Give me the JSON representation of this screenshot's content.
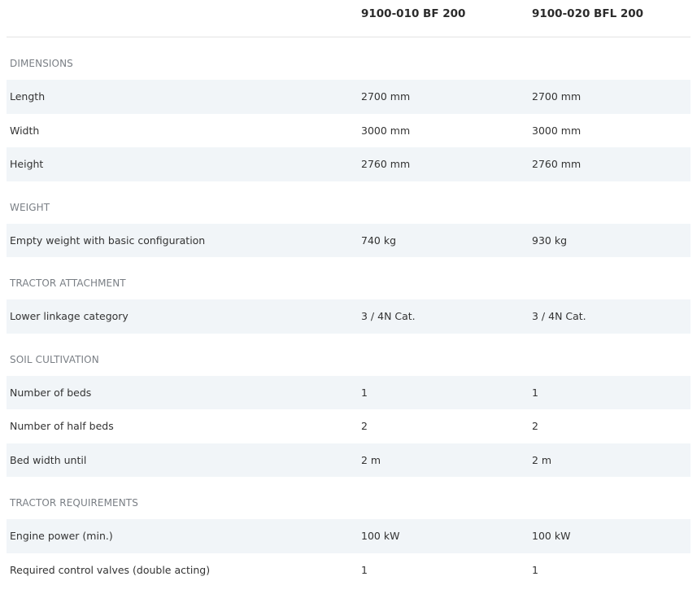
{
  "header": {
    "col1": "9100-010 BF 200",
    "col2": "9100-020 BFL 200"
  },
  "sections": [
    {
      "title": "DIMENSIONS",
      "rows": [
        {
          "label": "Length",
          "v1": "2700 mm",
          "v2": "2700 mm"
        },
        {
          "label": "Width",
          "v1": "3000 mm",
          "v2": "3000 mm"
        },
        {
          "label": "Height",
          "v1": "2760 mm",
          "v2": "2760 mm"
        }
      ]
    },
    {
      "title": "WEIGHT",
      "rows": [
        {
          "label": "Empty weight with basic configuration",
          "v1": "740 kg",
          "v2": "930 kg"
        }
      ]
    },
    {
      "title": "TRACTOR ATTACHMENT",
      "rows": [
        {
          "label": "Lower linkage category",
          "v1": "3 / 4N Cat.",
          "v2": "3 / 4N Cat."
        }
      ]
    },
    {
      "title": "SOIL CULTIVATION",
      "rows": [
        {
          "label": "Number of beds",
          "v1": "1",
          "v2": "1"
        },
        {
          "label": "Number of half beds",
          "v1": "2",
          "v2": "2"
        },
        {
          "label": "Bed width until",
          "v1": "2 m",
          "v2": "2 m"
        }
      ]
    },
    {
      "title": "TRACTOR REQUIREMENTS",
      "rows": [
        {
          "label": "Engine power (min.)",
          "v1": "100 kW",
          "v2": "100 kW"
        },
        {
          "label": "Required control valves (double acting)",
          "v1": "1",
          "v2": "1"
        }
      ]
    }
  ]
}
